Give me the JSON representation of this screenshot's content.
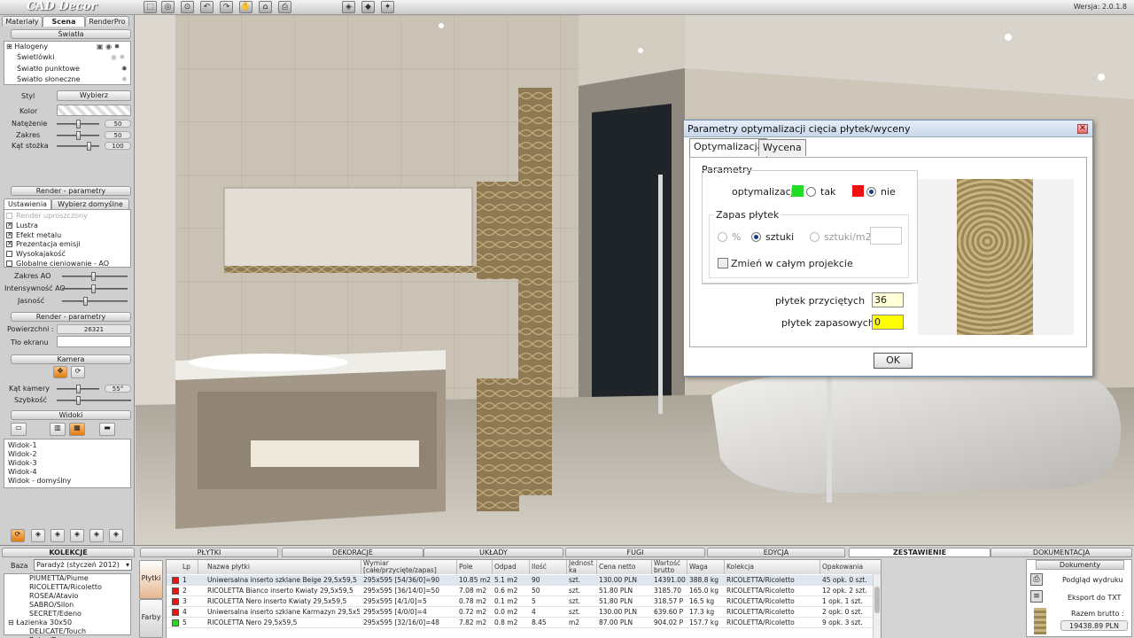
{
  "app": {
    "logo": "CAD Decor",
    "version": "Wersja: 2.0.1.8"
  },
  "toolbar": {
    "icons": [
      "select-icon",
      "orbit-icon",
      "zoom-icon",
      "undo-icon",
      "redo-icon",
      "hand-icon",
      "shirt-icon",
      "print-icon"
    ],
    "view_icons": [
      "cube-icon",
      "cube-side-icon",
      "render-icon"
    ]
  },
  "left": {
    "tabs": [
      "Materiały",
      "Scena",
      "RenderPro"
    ],
    "active_tab": "Scena",
    "lights_header": "Światła",
    "lights": [
      "Halogeny",
      "Świetlówki",
      "Światło punktowe",
      "Światło słoneczne"
    ],
    "styl_label": "Styl",
    "styl_button": "Wybierz",
    "kolor_label": "Kolor",
    "natezenie_label": "Natężenie",
    "natezenie_value": "50",
    "zakres_label": "Zakres",
    "zakres_value": "50",
    "kat_stozka_label": "Kąt stożka",
    "kat_stozka_value": "100",
    "render_header": "Render - parametry",
    "render_tabs": [
      "Ustawienia",
      "Wybierz domyślne"
    ],
    "render_options": [
      {
        "label": "Render uproszczony",
        "checked": false,
        "disabled": true
      },
      {
        "label": "Lustra",
        "checked": true,
        "disabled": false
      },
      {
        "label": "Efekt metalu",
        "checked": true,
        "disabled": false
      },
      {
        "label": "Prezentacja emisji",
        "checked": true,
        "disabled": false
      },
      {
        "label": "Wysokajakość",
        "checked": false,
        "disabled": false
      },
      {
        "label": "Globalne cieniowanie - AO",
        "checked": false,
        "disabled": false
      }
    ],
    "zakres_ao_label": "Zakres AO",
    "intensywnosc_ao_label": "Intensywność AO",
    "jasnosc_label": "Jasność",
    "render2_header": "Render - parametry",
    "powierzchni_label": "Powierzchni :",
    "powierzchni_value": "26321",
    "tlo_label": "Tło ekranu",
    "kamera_header": "Kamera",
    "kat_kamery_label": "Kąt kamery",
    "kat_kamery_value": "55°",
    "szybkosc_label": "Szybkość",
    "widoki_header": "Widoki",
    "views": [
      "Widok-1",
      "Widok-2",
      "Widok-3",
      "Widok-4",
      "Widok - domyślny"
    ]
  },
  "dialog": {
    "title": "Parametry optymalizacji cięcia płytek/wyceny",
    "close_glyph": "✕",
    "tabs": [
      "Optymalizacja",
      "Wycena"
    ],
    "group_title": "Parametry",
    "optymalizacja_label": "optymalizacja",
    "tak_label": "tak",
    "nie_label": "nie",
    "tak_color": "#22dd22",
    "nie_color": "#ee1111",
    "optymalizacja_selected": "nie",
    "zapas_title": "Zapas płytek",
    "zapas_options": [
      "%",
      "sztuki",
      "sztuki/m2"
    ],
    "zapas_selected": "sztuki",
    "zmien_label": "Zmień w całym projekcie",
    "przyciete_label": "płytek przyciętych",
    "przyciete_value": "36",
    "zapasowe_label": "płytek zapasowych",
    "zapasowe_value": "0",
    "ok_label": "OK"
  },
  "bottom": {
    "tabs": [
      "KOLEKCJE",
      "PŁYTKI",
      "DEKORACJE",
      "UKŁADY",
      "FUGI",
      "EDYCJA",
      "ZESTAWIENIE",
      "DOKUMENTACJA"
    ],
    "active_tab": "ZESTAWIENIE",
    "baza_label": "Baza",
    "baza_value": "Paradyż (styczeń 2012)",
    "collections": [
      "PIUMETTA/Piume",
      "RICOLETTA/Ricoletto",
      "ROSEA/Atavio",
      "SABRO/Silon",
      "SECRET/Edeno",
      "Łazienka 30x50",
      "DELICATE/Touch Beige/Brown"
    ],
    "side_tabs": [
      "Płytki",
      "Farby"
    ],
    "table_headers": [
      "Lp",
      "Nazwa płytki",
      "Wymiar [całe/przycięte/zapas]",
      "Pole",
      "Odpad",
      "Ilość",
      "Jednostka",
      "Cena netto",
      "Wartość brutto",
      "Waga",
      "Kolekcja",
      "Opakowania"
    ],
    "rows": [
      {
        "color": "#ee1111",
        "lp": "1",
        "name": "Uniwersalna inserto szklane Beige 29,5x59,5",
        "wymiar": "295x595   [54/36/0]=90",
        "pole": "10.85 m2",
        "odpad": "5.1 m2",
        "ilosc": "90",
        "jedn": "szt.",
        "cena": "130.00 PLN",
        "wartosc": "14391.00",
        "waga": "388.8 kg",
        "kolekcja": "RICOLETTA/Ricoletto",
        "opak": "45 opk. 0 szt."
      },
      {
        "color": "#ee1111",
        "lp": "2",
        "name": "RICOLETTA Bianco inserto Kwiaty 29,5x59,5",
        "wymiar": "295x595   [36/14/0]=50",
        "pole": "7.08 m2",
        "odpad": "0.6 m2",
        "ilosc": "50",
        "jedn": "szt.",
        "cena": "51.80 PLN",
        "wartosc": "3185.70",
        "waga": "165.0 kg",
        "kolekcja": "RICOLETTA/Ricoletto",
        "opak": "12 opk. 2 szt."
      },
      {
        "color": "#ee1111",
        "lp": "3",
        "name": "RICOLETTA Nero inserto Kwiaty 29,5x59,5",
        "wymiar": "295x595   [4/1/0]=5",
        "pole": "0.78 m2",
        "odpad": "0.1 m2",
        "ilosc": "5",
        "jedn": "szt.",
        "cena": "51.80 PLN",
        "wartosc": "318.57 P",
        "waga": "16.5 kg",
        "kolekcja": "RICOLETTA/Ricoletto",
        "opak": "1 opk. 1 szt."
      },
      {
        "color": "#ee1111",
        "lp": "4",
        "name": "Uniwersalna inserto szklane Karmazyn 29,5x59,5",
        "wymiar": "295x595   [4/0/0]=4",
        "pole": "0.72 m2",
        "odpad": "0.0 m2",
        "ilosc": "4",
        "jedn": "szt.",
        "cena": "130.00 PLN",
        "wartosc": "639.60 P",
        "waga": "17.3 kg",
        "kolekcja": "RICOLETTA/Ricoletto",
        "opak": "2 opk. 0 szt."
      },
      {
        "color": "#22dd22",
        "lp": "5",
        "name": "RICOLETTA Nero 29,5x59,5",
        "wymiar": "295x595   [32/16/0]=48",
        "pole": "7.82 m2",
        "odpad": "0.8 m2",
        "ilosc": "8.45",
        "jedn": "m2",
        "cena": "87.00 PLN",
        "wartosc": "904.02 P",
        "waga": "157.7 kg",
        "kolekcja": "RICOLETTA/Ricoletto",
        "opak": "9 opk. 3 szt."
      }
    ],
    "docs_header": "Dokumenty",
    "podglad_label": "Podgląd wydruku",
    "eksport_label": "Eksport do TXT",
    "razem_label": "Razem brutto :",
    "razem_value": "19438.89 PLN"
  }
}
